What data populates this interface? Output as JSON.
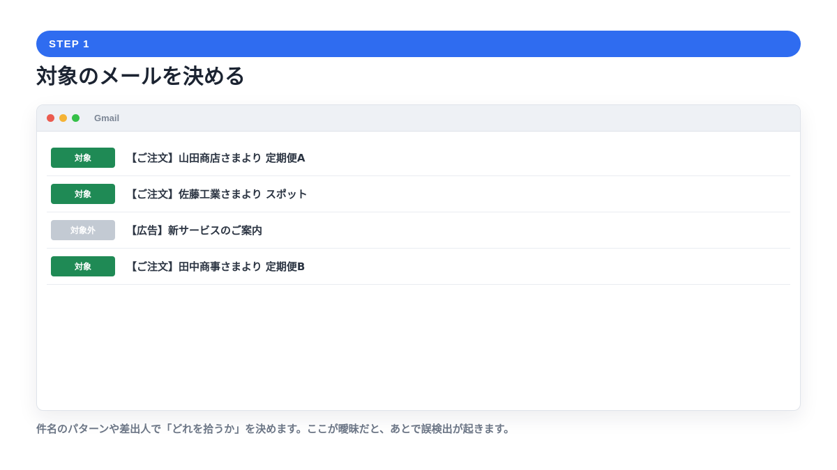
{
  "step": {
    "label": "STEP 1"
  },
  "title": "対象のメールを決める",
  "window": {
    "app_name": "Gmail",
    "mails": [
      {
        "badge": "対象",
        "status": "target",
        "subject": "【ご注文】山田商店さまより 定期便A"
      },
      {
        "badge": "対象",
        "status": "target",
        "subject": "【ご注文】佐藤工業さまより スポット"
      },
      {
        "badge": "対象外",
        "status": "excluded",
        "subject": "【広告】新サービスのご案内"
      },
      {
        "badge": "対象",
        "status": "target",
        "subject": "【ご注文】田中商事さまより 定期便B"
      }
    ]
  },
  "caption": "件名のパターンや差出人で「どれを拾うか」を決めます。ここが曖昧だと、あとで誤検出が起きます。",
  "colors": {
    "accent": "#2f6cf0",
    "target_badge": "#1f8a55",
    "excluded_badge": "#c3cad3"
  }
}
